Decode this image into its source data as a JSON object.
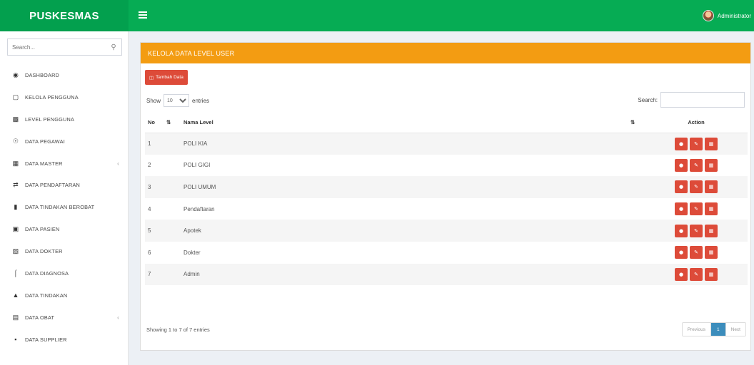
{
  "header": {
    "brand": "PUSKESMAS",
    "user_name": "Administrator"
  },
  "sidebar": {
    "search_placeholder": "Search...",
    "items": [
      {
        "label": "DASHBOARD",
        "icon": "dashboard-icon"
      },
      {
        "label": "KELOLA PENGGUNA",
        "icon": "file-icon"
      },
      {
        "label": "LEVEL PENGGUNA",
        "icon": "users-icon"
      },
      {
        "label": "DATA PEGAWAI",
        "icon": "user-circle-icon"
      },
      {
        "label": "DATA MASTER",
        "icon": "grid-icon"
      },
      {
        "label": "DATA PENDAFTARAN",
        "icon": "transfer-icon"
      },
      {
        "label": "DATA TINDAKAN BEROBAT",
        "icon": "comments-icon"
      },
      {
        "label": "DATA PASIEN",
        "icon": "patient-icon"
      },
      {
        "label": "DATA DOKTER",
        "icon": "id-card-icon"
      },
      {
        "label": "DATA DIAGNOSA",
        "icon": "stethoscope-icon"
      },
      {
        "label": "DATA TINDAKAN",
        "icon": "user-md-icon"
      },
      {
        "label": "DATA OBAT",
        "icon": "medicine-icon"
      },
      {
        "label": "DATA SUPPLIER",
        "icon": "truck-icon"
      }
    ]
  },
  "panel": {
    "title": "KELOLA DATA LEVEL USER",
    "add_button": "Tambah Data",
    "show_label": "Show",
    "entries_label": "entries",
    "length_value": "10",
    "search_label": "Search:",
    "columns": {
      "no": "No",
      "name": "Nama Level",
      "action": "Action"
    },
    "rows": [
      {
        "no": "1",
        "name": "POLI KIA"
      },
      {
        "no": "2",
        "name": "POLI GIGI"
      },
      {
        "no": "3",
        "name": "POLI UMUM"
      },
      {
        "no": "4",
        "name": "Pendaftaran"
      },
      {
        "no": "5",
        "name": "Apotek"
      },
      {
        "no": "6",
        "name": "Dokter"
      },
      {
        "no": "7",
        "name": "Admin"
      }
    ],
    "info": "Showing 1 to 7 of 7 entries",
    "pagination": {
      "previous": "Previous",
      "current": "1",
      "next": "Next"
    }
  },
  "colors": {
    "brand_green": "#03a04e",
    "header_orange": "#f39c12",
    "danger_red": "#dd4b39",
    "pager_blue": "#3c8dbc"
  }
}
